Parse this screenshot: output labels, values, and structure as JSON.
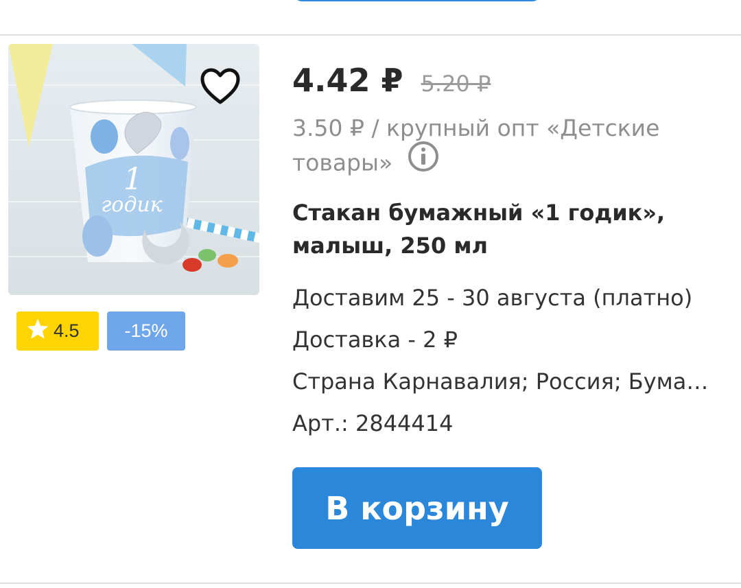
{
  "product": {
    "price": "4.42 ₽",
    "old_price": "5.20 ₽",
    "wholesale_text": "3.50 ₽ / крупный опт «Детские товары»",
    "title": "Стакан бумажный «1 годик», малыш, 250 мл",
    "delivery_date": "Доставим 25 - 30 августа (платно)",
    "delivery_cost": "Доставка - 2 ₽",
    "properties": "Страна Карнавалия; Россия; Бумага",
    "article": "Арт.: 2844414",
    "rating": "4.5",
    "discount": "-15%",
    "image_text": "1 годик"
  },
  "actions": {
    "add_to_cart": "В корзину"
  },
  "colors": {
    "primary": "#2a87d9",
    "rating_badge": "#ffd400",
    "discount_badge": "#6fa6e9"
  },
  "icons": [
    "heart-icon",
    "star-icon",
    "info-icon"
  ]
}
